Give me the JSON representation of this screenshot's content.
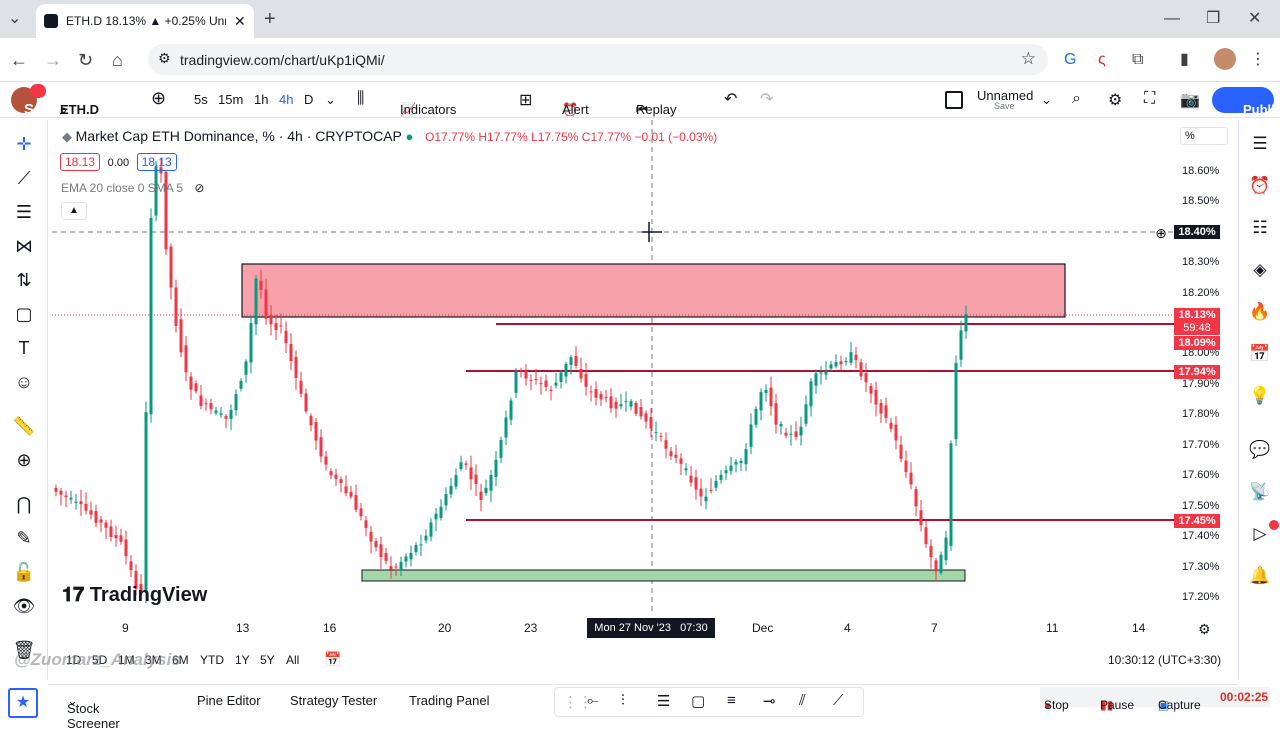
{
  "browser": {
    "tab_title": "ETH.D 18.13% ▲ +0.25% Unna",
    "url": "tradingview.com/chart/uKp1iQMi/"
  },
  "toolbar": {
    "avatar_letter": "S",
    "notif_count": "11",
    "symbol": "ETH.D",
    "intervals": [
      "5s",
      "15m",
      "1h",
      "4h",
      "D"
    ],
    "indicators_label": "Indicators",
    "alert_label": "Alert",
    "replay_label": "Replay",
    "layout_name": "Unnamed",
    "layout_save": "Save",
    "publish_label": "Publish"
  },
  "legend": {
    "title": "Market Cap ETH Dominance, % · 4h · CRYPTOCAP",
    "ohlc": "O17.77% H17.77% L17.75% C17.77% −0.01 (−0.03%)",
    "bid": "18.13",
    "spread": "0.00",
    "ask": "18.13",
    "indicator": "EMA 20 close 0 SMA 5"
  },
  "watermark": "TradingView",
  "overlay_text": "@Zuomarz_Analysis",
  "yaxis": {
    "scale_mode": "%",
    "ticks": [
      "18.60%",
      "18.50%",
      "18.40%",
      "18.30%",
      "18.20%",
      "18.00%",
      "17.90%",
      "17.80%",
      "17.70%",
      "17.60%",
      "17.50%",
      "17.40%",
      "17.30%",
      "17.20%"
    ],
    "crosshair_label": "18.40%",
    "price_label": "18.13%",
    "countdown": "59:48",
    "line1_label": "18.09%",
    "line2_label": "17.94%",
    "line3_label": "17.45%"
  },
  "xaxis": {
    "ticks": [
      "9",
      "13",
      "16",
      "20",
      "23",
      "Dec",
      "4",
      "7",
      "11",
      "14"
    ],
    "crosshair_label": "Mon 27 Nov '23   07:30"
  },
  "ranges": [
    "1D",
    "5D",
    "1M",
    "3M",
    "6M",
    "YTD",
    "1Y",
    "5Y",
    "All"
  ],
  "clock": "10:30:12 (UTC+3:30)",
  "bottom": {
    "tabs": [
      "Stock Screener",
      "Pine Editor",
      "Strategy Tester",
      "Trading Panel"
    ],
    "stop": "Stop",
    "pause": "Pause",
    "capture": "Capture",
    "timer": "00:02:25"
  },
  "colors": {
    "up": "#089981",
    "down": "#f23645",
    "resistance_zone": "#f7a1ab",
    "support_zone": "#a5d6a7",
    "level_line": "#b2102f",
    "publish": "#2962ff"
  }
}
